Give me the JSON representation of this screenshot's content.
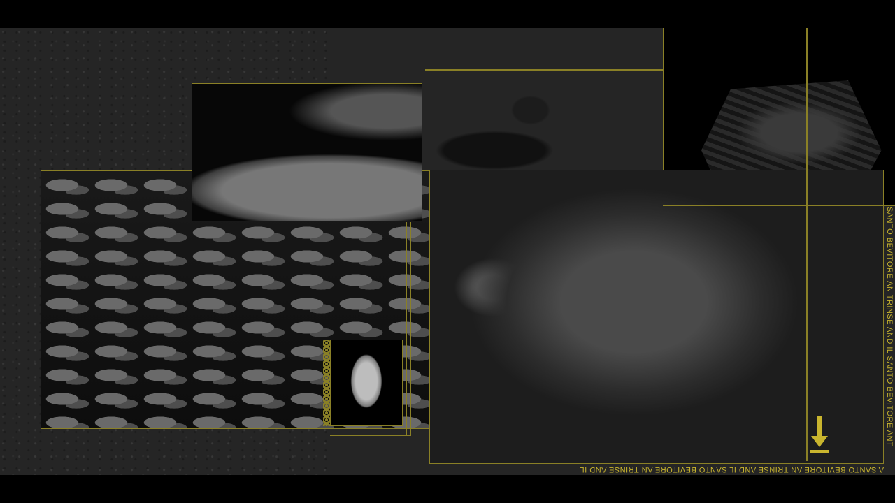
{
  "scroll_text": {
    "vertical": "SANTO BEVITORE  AN TRINSE AND IL SANTO BEVITORE  ANT",
    "horizontal": "A SANTO BEVITORE AN TRINSE AND IL SANTO BEVITORE AN TRINSE AND IL"
  },
  "icons": {
    "scroll_indicator": "down-arrow-icon"
  },
  "colors": {
    "accent": "#c9b52e",
    "frame": "#8a8026",
    "background": "#252525"
  }
}
